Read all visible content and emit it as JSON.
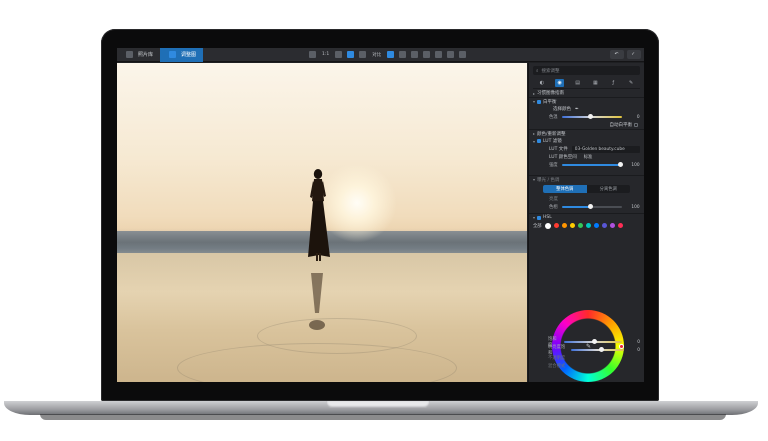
{
  "topbar": {
    "tab_library": "照片库",
    "tab_edit": "调整图",
    "zoom_label": "1:1",
    "view_label": "对比",
    "btn_undo": "",
    "btn_done": ""
  },
  "panel": {
    "search_placeholder": "搜索调整",
    "sections": {
      "quick": "习惯图像指南",
      "white_balance": "白平衡",
      "eyedropper": "选择颜色",
      "temperature": "色温",
      "tint_value": "0",
      "auto": "自动白平衡",
      "lut_section": "颜色/重新调整",
      "lut_label": "LUT 滤镜",
      "lut_file_label": "LUT 文件",
      "lut_file_value": "03-Golden beauty.cube",
      "lut_type_label": "LUT 颜色空间",
      "lut_type_value": "标准",
      "amount_label": "强度",
      "amount_value": "100",
      "tone_section": "曝光 / 色调",
      "seg_a": "整体色调",
      "seg_b": "分离色调",
      "brightness_label": "亮度",
      "hue_row_label": "色相",
      "hue_row_value": "100",
      "hsl": "HSL",
      "hsl_scope": "全部",
      "sat_label": "饱和度",
      "sat_value": "0",
      "lum_label": "明亮度饱和",
      "lum_value": "0",
      "opacity_label": "不透明度",
      "opacity_value": "",
      "blend_label": "混合模式",
      "blend_value": ""
    },
    "swatch_colors": [
      "#ffffff",
      "#ff3b30",
      "#ff9500",
      "#ffcc00",
      "#34c759",
      "#00c7be",
      "#007aff",
      "#5856d6",
      "#af52de",
      "#ff2d55"
    ]
  }
}
